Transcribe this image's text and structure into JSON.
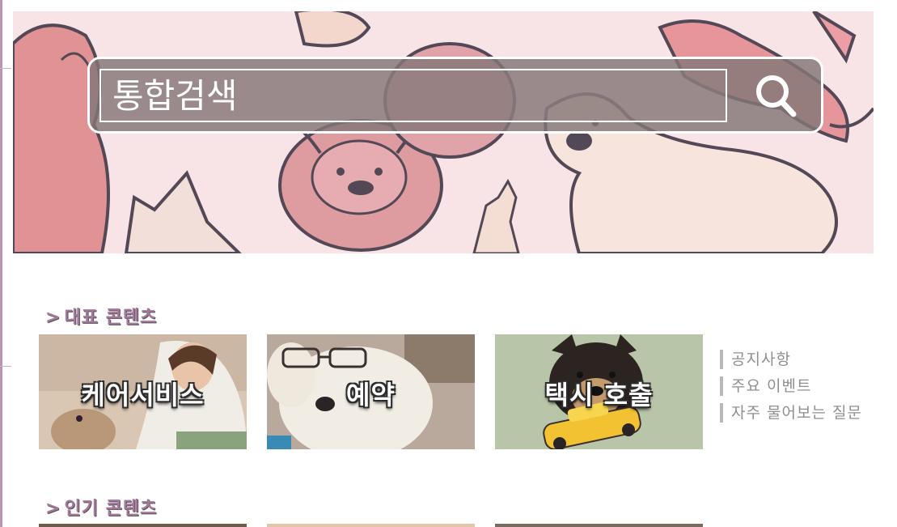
{
  "search": {
    "placeholder": "통합검색",
    "button_icon": "search-icon"
  },
  "sections": {
    "featured": {
      "arrow": ">",
      "title": "대표 콘텐츠"
    },
    "popular": {
      "arrow": ">",
      "title": "인기 콘텐츠"
    }
  },
  "featured_cards": [
    {
      "label": "케어서비스"
    },
    {
      "label": "예약"
    },
    {
      "label": "택시 호출"
    }
  ],
  "side_links": [
    {
      "label": "공지사항"
    },
    {
      "label": "주요 이벤트"
    },
    {
      "label": "자주 물어보는 질문"
    }
  ],
  "colors": {
    "accent": "#a07a98",
    "rail": "#b895b2",
    "search_bg": "#827676",
    "side_link_text": "#8f8f8f"
  }
}
